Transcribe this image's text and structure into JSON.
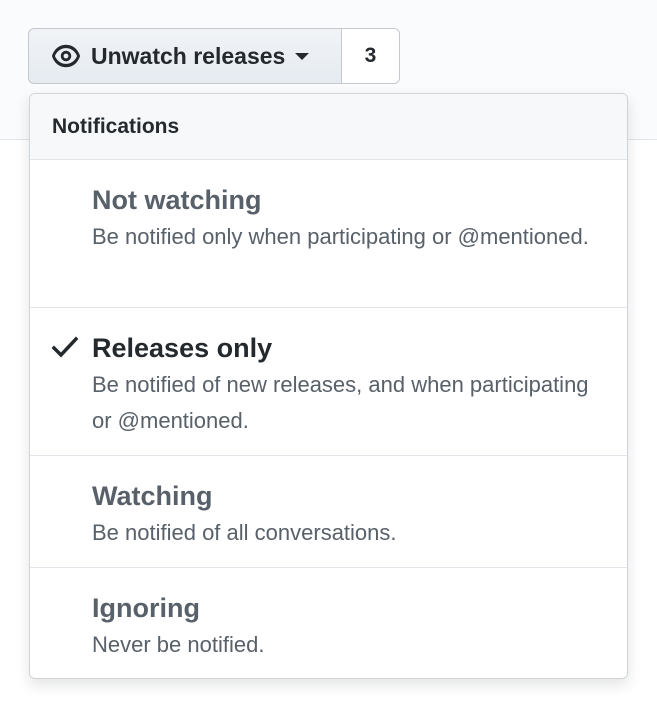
{
  "watch_button": {
    "label": "Unwatch releases",
    "icon": "eye-icon",
    "caret_icon": "caret-down-icon",
    "count": "3"
  },
  "menu": {
    "header": "Notifications",
    "items": [
      {
        "title": "Not watching",
        "description": "Be notified only when participating or @mentioned.",
        "selected": false
      },
      {
        "title": "Releases only",
        "description": "Be notified of new releases, and when participating or @mentioned.",
        "selected": true
      },
      {
        "title": "Watching",
        "description": "Be notified of all conversations.",
        "selected": false
      },
      {
        "title": "Ignoring",
        "description": "Never be notified.",
        "selected": false
      }
    ]
  },
  "colors": {
    "text_primary": "#24292e",
    "text_muted": "#586069",
    "border": "#e1e4e8",
    "header_bg": "#f6f8fa"
  }
}
